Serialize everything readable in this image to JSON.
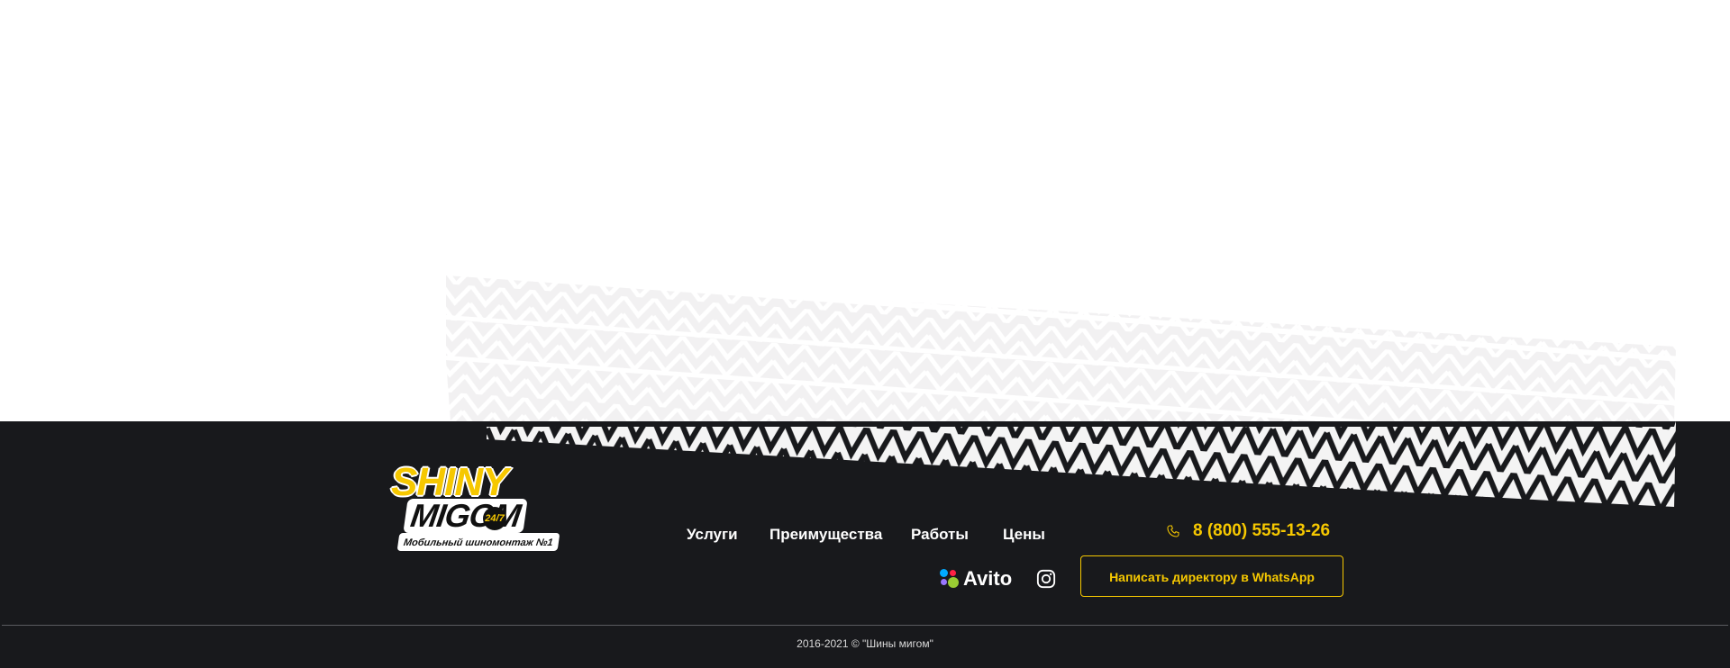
{
  "logo": {
    "line1": "SHINY",
    "line2": "MIGOM",
    "badge": "24/7",
    "tagline": "Мобильный шиномонтаж №1"
  },
  "nav": [
    {
      "label": "Услуги"
    },
    {
      "label": "Преимущества"
    },
    {
      "label": "Работы"
    },
    {
      "label": "Цены"
    }
  ],
  "contacts": {
    "phone": "8 (800) 555-13-26",
    "phone_icon": "phone-icon"
  },
  "social": {
    "avito_label": "Avito",
    "avito_dot_colors": [
      "#0af",
      "#f24",
      "#9c3",
      "#97f"
    ],
    "instagram_icon": "instagram-icon"
  },
  "cta": {
    "whatsapp_label": "Написать директору в WhatsApp"
  },
  "footer": {
    "copyright": "2016-2021 © \"Шины мигом\""
  },
  "colors": {
    "accent": "#f6c800",
    "footer_bg": "#18191c",
    "tread_light": "#f0eff0"
  }
}
